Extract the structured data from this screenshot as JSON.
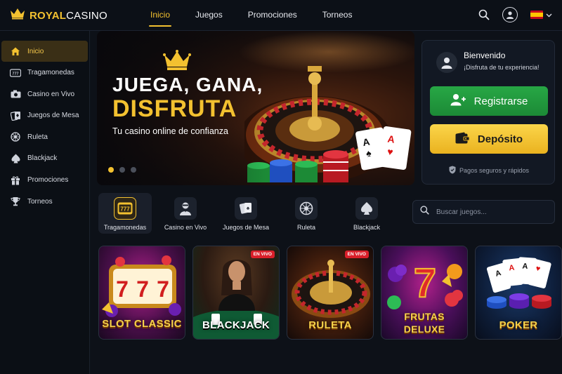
{
  "header": {
    "logo_royal": "ROYAL",
    "logo_casino": "CASINO",
    "nav": [
      {
        "label": "Inicio",
        "active": true
      },
      {
        "label": "Juegos",
        "active": false
      },
      {
        "label": "Promociones",
        "active": false
      },
      {
        "label": "Torneos",
        "active": false
      }
    ],
    "icons": [
      "search-icon",
      "user-icon",
      "spain-flag-icon",
      "chevron-down-icon"
    ]
  },
  "sidebar": {
    "items": [
      {
        "label": "Inicio",
        "icon": "home-icon",
        "active": true
      },
      {
        "label": "Tragamonedas",
        "icon": "slot-icon",
        "active": false
      },
      {
        "label": "Casino en Vivo",
        "icon": "camera-icon",
        "active": false
      },
      {
        "label": "Juegos de Mesa",
        "icon": "cards-icon",
        "active": false
      },
      {
        "label": "Ruleta",
        "icon": "roulette-icon",
        "active": false
      },
      {
        "label": "Blackjack",
        "icon": "spade-icon",
        "active": false
      },
      {
        "label": "Promociones",
        "icon": "gift-icon",
        "active": false
      },
      {
        "label": "Torneos",
        "icon": "trophy-icon",
        "active": false
      }
    ]
  },
  "banner": {
    "title_line1": "JUEGA, GANA,",
    "title_line2": "DISFRUTA",
    "subtitle": "Tu casino online de confianza",
    "slides": 3,
    "active_slide": 1
  },
  "welcome": {
    "title": "Bienvenido",
    "subtitle": "¡Disfruta de tu experiencia!",
    "register_label": "Registrarse",
    "deposit_label": "Depósito",
    "secure_text": "Pagos seguros y rápidos"
  },
  "categories": [
    {
      "label": "Tragamonedas",
      "icon": "slot-777-icon",
      "active": true
    },
    {
      "label": "Casino en Vivo",
      "icon": "dealer-icon",
      "active": false
    },
    {
      "label": "Juegos de Mesa",
      "icon": "cards-icon",
      "active": false
    },
    {
      "label": "Ruleta",
      "icon": "roulette-icon",
      "active": false
    },
    {
      "label": "Blackjack",
      "icon": "spade-icon",
      "active": false
    }
  ],
  "search": {
    "placeholder": "Buscar juegos..."
  },
  "games": [
    {
      "title": "SLOT CLASSIC",
      "live": ""
    },
    {
      "title": "BLACKJACK",
      "live": "EN VIVO"
    },
    {
      "title": "RULETA",
      "live": "EN VIVO"
    },
    {
      "title_line1": "FRUTAS",
      "title_line2": "DELUXE",
      "live": ""
    },
    {
      "title": "POKER",
      "live": ""
    }
  ],
  "colors": {
    "accent": "#f3c130",
    "background": "#0d1118",
    "register": "#27a745",
    "live_badge": "#d91f2a"
  }
}
